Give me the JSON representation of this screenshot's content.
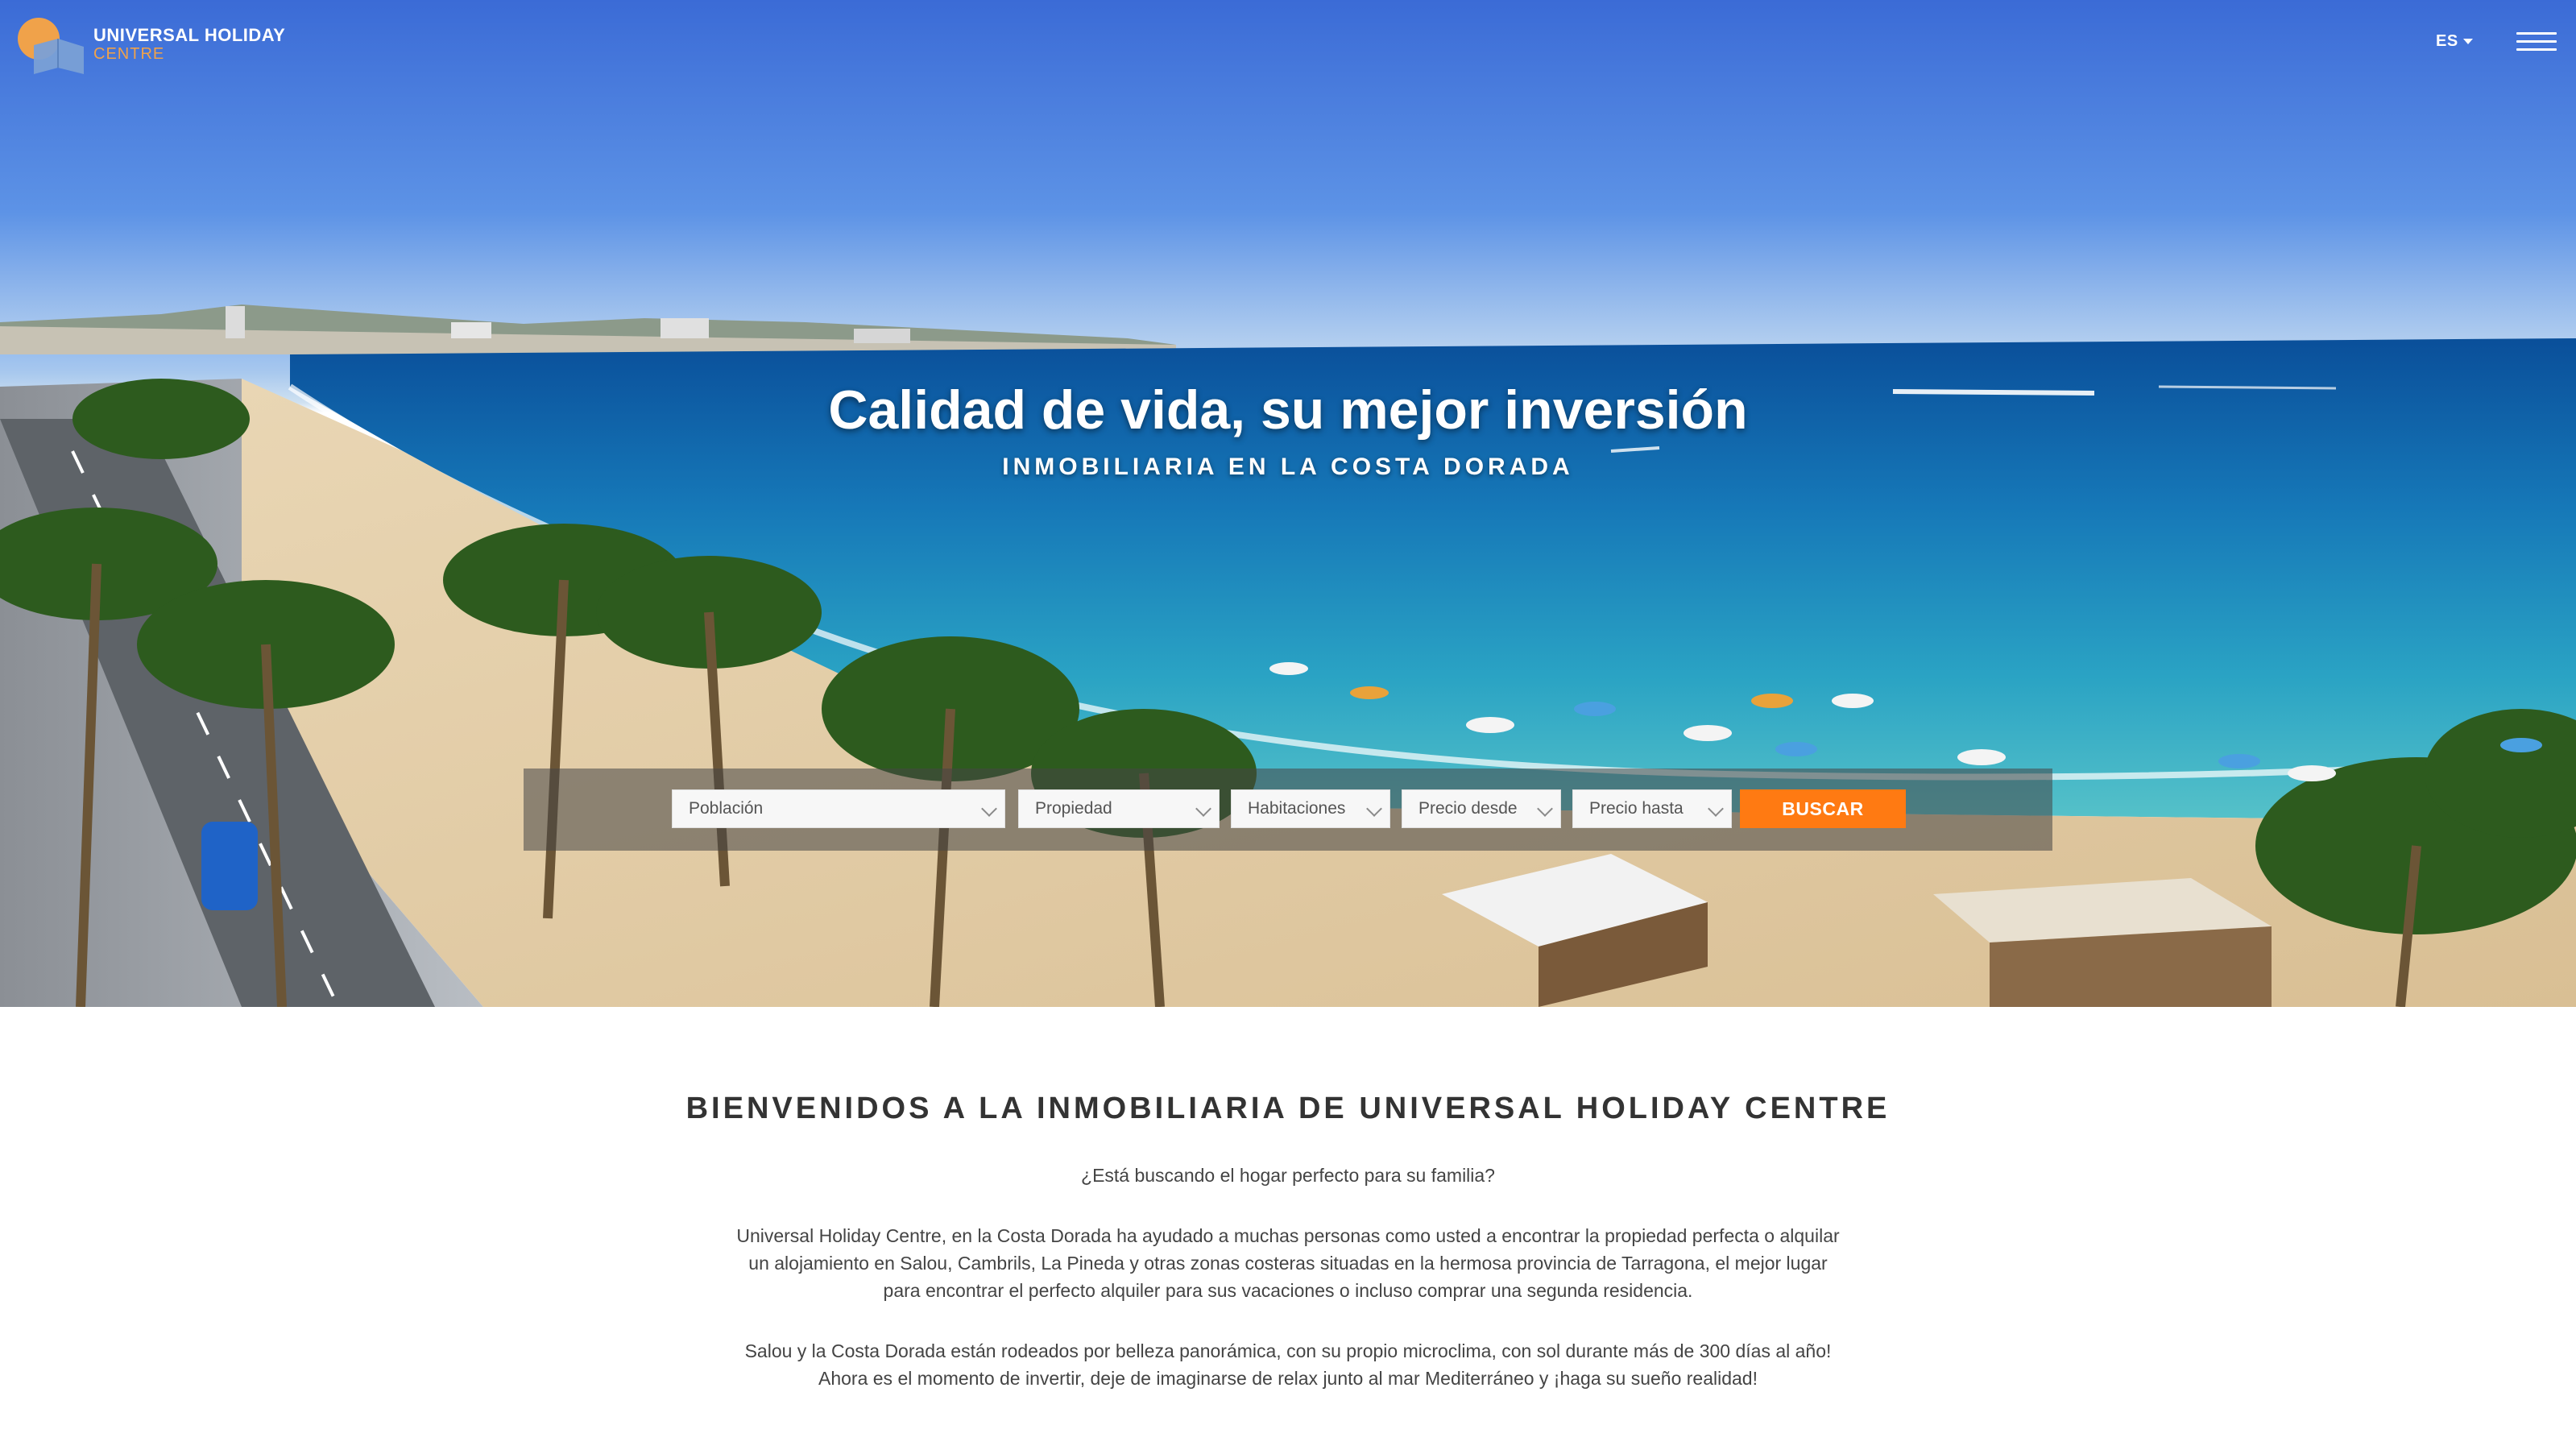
{
  "header": {
    "logo_line1": "UNIVERSAL HOLIDAY",
    "logo_line2": "CENTRE",
    "language": "ES",
    "logo_colors": {
      "orange": "#f0a24a",
      "blue": "#7aa0d6"
    }
  },
  "hero": {
    "title": "Calidad de vida, su mejor inversión",
    "subtitle": "INMOBILIARIA EN LA COSTA DORADA"
  },
  "search": {
    "fields": [
      {
        "label": "Población"
      },
      {
        "label": "Propiedad"
      },
      {
        "label": "Habitaciones"
      },
      {
        "label": "Precio desde"
      },
      {
        "label": "Precio hasta"
      }
    ],
    "button_label": "BUSCAR",
    "button_color": "#ff7a12"
  },
  "welcome": {
    "title": "BIENVENIDOS A LA INMOBILIARIA DE UNIVERSAL HOLIDAY CENTRE",
    "question": "¿Está buscando el hogar perfecto para su familia?",
    "paragraph1_lines": [
      "Universal Holiday Centre, en la Costa Dorada ha ayudado a muchas personas como usted a encontrar la propiedad perfecta o alquilar",
      "un alojamiento en Salou, Cambrils, La Pineda y otras zonas costeras situadas en la hermosa provincia de Tarragona, el mejor lugar",
      "para encontrar el perfecto alquiler para sus vacaciones o incluso comprar una segunda residencia."
    ],
    "paragraph2_lines": [
      "Salou y la Costa Dorada están rodeados por belleza panorámica, con su propio microclima, con sol durante más de 300 días al año!",
      "Ahora es el momento de invertir, deje de imaginarse de relax junto al mar Mediterráneo y ¡haga su sueño realidad!"
    ]
  }
}
